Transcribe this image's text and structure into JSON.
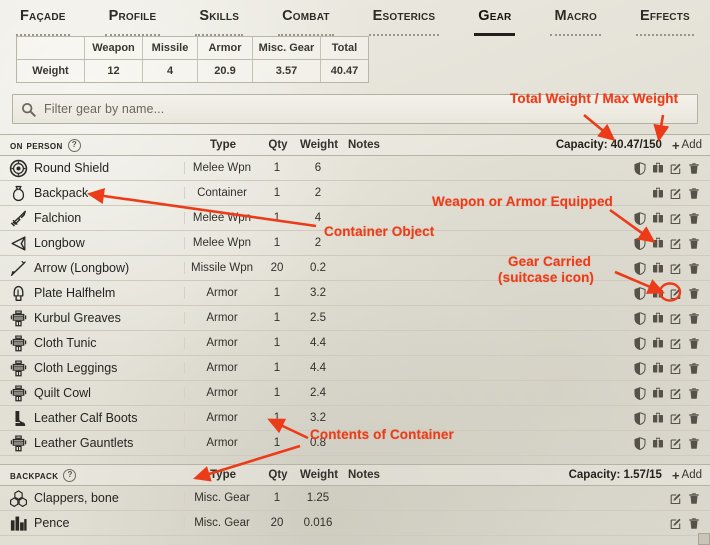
{
  "tabs": [
    {
      "label": "Façade",
      "active": false
    },
    {
      "label": "Profile",
      "active": false
    },
    {
      "label": "Skills",
      "active": false
    },
    {
      "label": "Combat",
      "active": false
    },
    {
      "label": "Esoterics",
      "active": false
    },
    {
      "label": "Gear",
      "active": true
    },
    {
      "label": "Macro",
      "active": false
    },
    {
      "label": "Effects",
      "active": false
    }
  ],
  "weight_table": {
    "headers": [
      "",
      "Weapon",
      "Missile",
      "Armor",
      "Misc. Gear",
      "Total"
    ],
    "row_label": "Weight",
    "values": [
      "12",
      "4",
      "20.9",
      "3.57",
      "40.47"
    ]
  },
  "search": {
    "placeholder": "Filter gear by name...",
    "value": "",
    "icon": "search-icon"
  },
  "columns": {
    "type": "Type",
    "qty": "Qty",
    "weight": "Weight",
    "notes": "Notes"
  },
  "sections": [
    {
      "title": "On Person",
      "help_icon": "question-icon",
      "capacity": "Capacity: 40.47/150",
      "add_label": "Add",
      "rows": [
        {
          "icon": "round-shield-icon",
          "name": "Round Shield",
          "type": "Melee Wpn",
          "qty": "1",
          "weight": "6",
          "notes": "",
          "actions": [
            "equip-shield-icon",
            "carry-suitcase-icon",
            "edit-icon",
            "delete-icon"
          ]
        },
        {
          "icon": "backpack-icon",
          "name": "Backpack",
          "type": "Container",
          "qty": "1",
          "weight": "2",
          "notes": "",
          "actions": [
            "carry-suitcase-icon",
            "edit-icon",
            "delete-icon"
          ]
        },
        {
          "icon": "sword-icon",
          "name": "Falchion",
          "type": "Melee Wpn",
          "qty": "1",
          "weight": "4",
          "notes": "",
          "actions": [
            "equip-shield-icon",
            "carry-suitcase-icon",
            "edit-icon",
            "delete-icon"
          ]
        },
        {
          "icon": "bow-icon",
          "name": "Longbow",
          "type": "Melee Wpn",
          "qty": "1",
          "weight": "2",
          "notes": "",
          "actions": [
            "equip-shield-icon",
            "carry-suitcase-icon",
            "edit-icon",
            "delete-icon"
          ]
        },
        {
          "icon": "arrow-icon",
          "name": "Arrow (Longbow)",
          "type": "Missile Wpn",
          "qty": "20",
          "weight": "0.2",
          "notes": "",
          "actions": [
            "equip-shield-icon",
            "carry-suitcase-icon",
            "edit-icon",
            "delete-icon"
          ]
        },
        {
          "icon": "helm-icon",
          "name": "Plate Halfhelm",
          "type": "Armor",
          "qty": "1",
          "weight": "3.2",
          "notes": "",
          "actions": [
            "equip-shield-icon",
            "carry-suitcase-icon",
            "edit-icon",
            "delete-icon"
          ],
          "highlight_action": 1
        },
        {
          "icon": "armor-icon",
          "name": "Kurbul Greaves",
          "type": "Armor",
          "qty": "1",
          "weight": "2.5",
          "notes": "",
          "actions": [
            "equip-shield-icon",
            "carry-suitcase-icon",
            "edit-icon",
            "delete-icon"
          ]
        },
        {
          "icon": "armor-icon",
          "name": "Cloth Tunic",
          "type": "Armor",
          "qty": "1",
          "weight": "4.4",
          "notes": "",
          "actions": [
            "equip-shield-icon",
            "carry-suitcase-icon",
            "edit-icon",
            "delete-icon"
          ]
        },
        {
          "icon": "armor-icon",
          "name": "Cloth Leggings",
          "type": "Armor",
          "qty": "1",
          "weight": "4.4",
          "notes": "",
          "actions": [
            "equip-shield-icon",
            "carry-suitcase-icon",
            "edit-icon",
            "delete-icon"
          ]
        },
        {
          "icon": "armor-icon",
          "name": "Quilt Cowl",
          "type": "Armor",
          "qty": "1",
          "weight": "2.4",
          "notes": "",
          "actions": [
            "equip-shield-icon",
            "carry-suitcase-icon",
            "edit-icon",
            "delete-icon"
          ]
        },
        {
          "icon": "boot-icon",
          "name": "Leather Calf Boots",
          "type": "Armor",
          "qty": "1",
          "weight": "3.2",
          "notes": "",
          "actions": [
            "equip-shield-icon",
            "carry-suitcase-icon",
            "edit-icon",
            "delete-icon"
          ]
        },
        {
          "icon": "armor-icon",
          "name": "Leather Gauntlets",
          "type": "Armor",
          "qty": "1",
          "weight": "0.8",
          "notes": "",
          "actions": [
            "equip-shield-icon",
            "carry-suitcase-icon",
            "edit-icon",
            "delete-icon"
          ]
        }
      ]
    },
    {
      "title": "Backpack",
      "help_icon": "question-icon",
      "capacity": "Capacity: 1.57/15",
      "add_label": "Add",
      "rows": [
        {
          "icon": "clappers-icon",
          "name": "Clappers, bone",
          "type": "Misc. Gear",
          "qty": "1",
          "weight": "1.25",
          "notes": "",
          "actions": [
            "edit-icon",
            "delete-icon"
          ]
        },
        {
          "icon": "coins-icon",
          "name": "Pence",
          "type": "Misc. Gear",
          "qty": "20",
          "weight": "0.016",
          "notes": "",
          "actions": [
            "edit-icon",
            "delete-icon"
          ]
        }
      ]
    }
  ],
  "annotations": {
    "color": "#ec3b19",
    "items": [
      {
        "id": "total-weight-max-weight",
        "text": "Total Weight / Max Weight"
      },
      {
        "id": "weapon-or-armor-equipped",
        "text": "Weapon or Armor Equipped"
      },
      {
        "id": "container-object",
        "text": "Container Object"
      },
      {
        "id": "gear-carried-line1",
        "text": "Gear Carried"
      },
      {
        "id": "gear-carried-line2",
        "text": "(suitcase icon)"
      },
      {
        "id": "contents-of-container",
        "text": "Contents of Container"
      }
    ]
  }
}
